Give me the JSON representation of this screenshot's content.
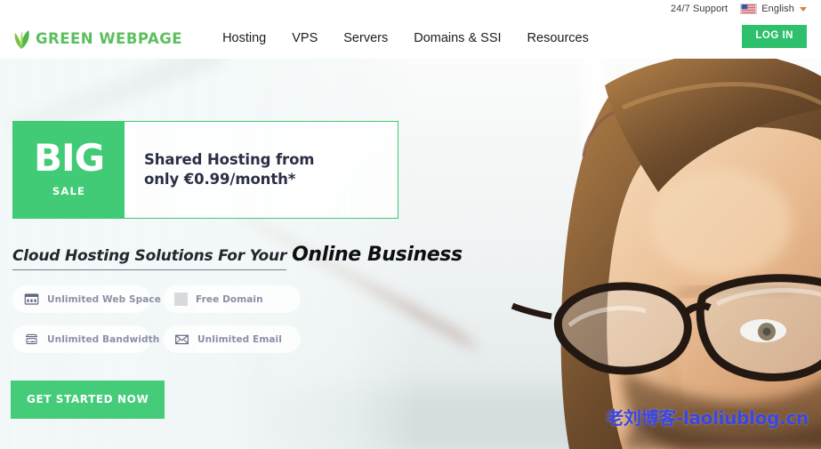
{
  "topbar": {
    "support_label": "24/7 Support",
    "language_label": "English",
    "flag_icon": "us-flag-icon",
    "caret_icon": "chevron-down-icon"
  },
  "header": {
    "logo_text": "GREEN WEBPAGE",
    "logo_icon": "leaf-icon",
    "nav": [
      {
        "label": "Hosting"
      },
      {
        "label": "VPS"
      },
      {
        "label": "Servers"
      },
      {
        "label": "Domains & SSI"
      },
      {
        "label": "Resources"
      }
    ],
    "login_label": "LOG IN"
  },
  "hero": {
    "banner": {
      "big_word": "BIG",
      "sale_word": "SALE",
      "line1": "Shared Hosting from",
      "line2": "only €0.99/month*"
    },
    "headline": {
      "light": "Cloud Hosting Solutions For Your",
      "strong": "Online Business"
    },
    "features": [
      {
        "label": "Unlimited Web Space",
        "icon": "browser-www-icon"
      },
      {
        "label": "Free Domain",
        "icon": "blank-square-icon"
      },
      {
        "label": "Unlimited Bandwidth",
        "icon": "server-icon"
      },
      {
        "label": "Unlimited Email",
        "icon": "envelope-icon"
      }
    ],
    "cta_label": "GET STARTED NOW",
    "watermark": "老刘博客-laoliublog.cn"
  },
  "colors": {
    "brand_green": "#41cb76",
    "login_green": "#2ec06c",
    "cta_green": "#44cc79",
    "logo_green": "#5cbf5c",
    "pill_text": "#8a90a6",
    "watermark_blue": "#3b46e0"
  }
}
